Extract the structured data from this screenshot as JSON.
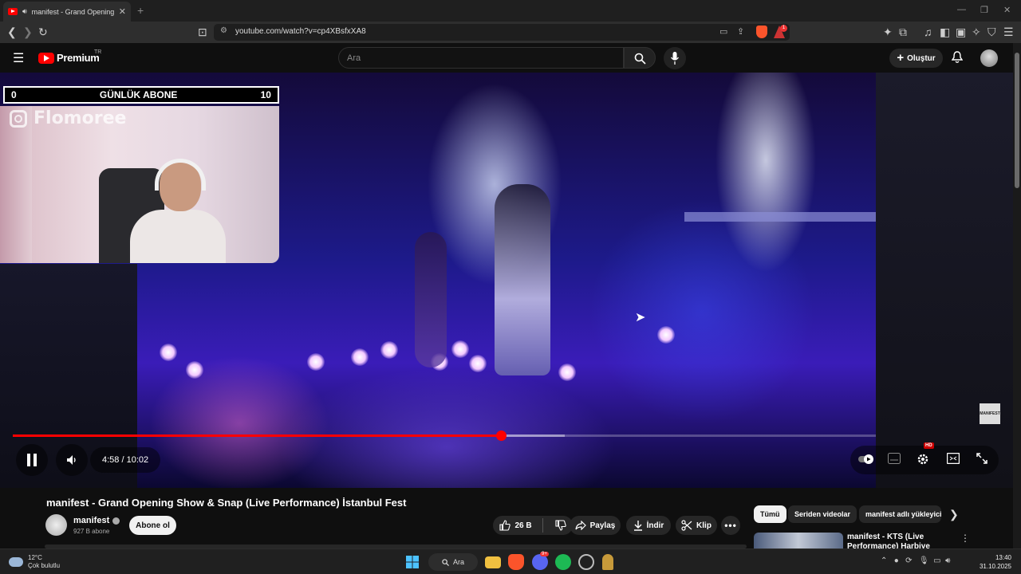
{
  "browser": {
    "tab_title": "manifest - Grand Opening Sh",
    "url": "youtube.com/watch?v=cp4XBsfxXA8",
    "shield_badge": "1"
  },
  "youtube": {
    "logo_text": "Premium",
    "logo_region": "TR",
    "search_placeholder": "Ara",
    "create_label": "Oluştur"
  },
  "overlay": {
    "counter_left": "0",
    "counter_title": "GÜNLÜK ABONE",
    "counter_right": "10",
    "instagram_handle": "Flomoree"
  },
  "player": {
    "time": "4:58 / 10:02",
    "progress_fraction": 0.566,
    "buffered_fraction": 0.64,
    "hd_badge": "HD",
    "watermark_text": "MANIFEST"
  },
  "video": {
    "title": "manifest - Grand Opening Show & Snap (Live Performance) İstanbul Fest",
    "channel_name": "manifest",
    "subscribers": "927 B abone",
    "subscribe_label": "Abone ol",
    "like_count": "26 B",
    "share_label": "Paylaş",
    "download_label": "İndir",
    "clip_label": "Klip"
  },
  "related": {
    "chips": [
      "Tümü",
      "Seriden videolar",
      "manifest adlı yükleyici"
    ],
    "first_title": "manifest - KTS (Live Performance) Harbiye"
  },
  "taskbar": {
    "temperature": "12°C",
    "weather": "Çok bulutlu",
    "search_label": "Ara",
    "time": "13:40",
    "date": "31.10.2025",
    "discord_badge": "9+"
  },
  "colors": {
    "youtube_red": "#ff0000",
    "background": "#0f0f0f"
  }
}
